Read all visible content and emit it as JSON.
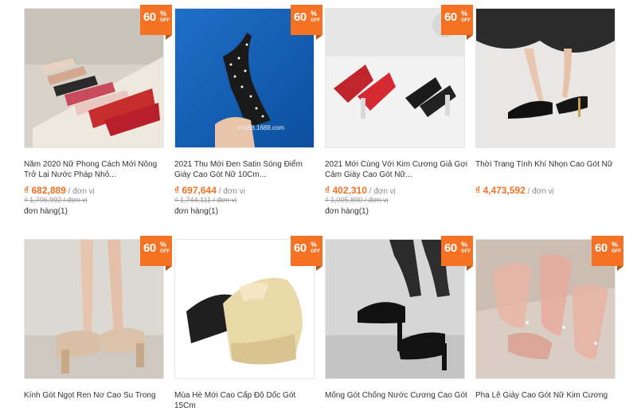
{
  "badge": {
    "percent": "60",
    "symbol": "%",
    "off": "OFF"
  },
  "products": [
    {
      "title": "Năm 2020 Nữ Phong Cách Mới Nông\nTrở Lại Nước Pháp Nhỏ...",
      "price": "₫ 682,889",
      "unit": " / đơn vị",
      "old_price": "₫ 1,706,992 / đơn vị",
      "orders": "đơn hàng(1)"
    },
    {
      "title": "2021 Thu Mới Đen Satin Sóng Điểm\nGiày Cao Gót Nữ 10Cm...",
      "price": "₫ 697,644",
      "unit": " / đơn vị",
      "old_price": "₫ 1,744,111 / đơn vị",
      "orders": "đơn hàng(1)",
      "watermark": "ecd88.1688.com"
    },
    {
      "title": "2021 Mới Cùng Với Kim Cương Giả Gợi\nCảm Giày Cao Gót Nữ...",
      "price": "₫ 402,310",
      "unit": " / đơn vị",
      "old_price": "₫ 1,005,890 / đơn vị",
      "orders": "đơn hàng(1)"
    },
    {
      "title": "Thời Trang Tính Khí Nhọn Cao Gót Nữ",
      "price": "₫ 4,473,592",
      "unit": " / đơn vị",
      "old_price": "",
      "orders": ""
    },
    {
      "title": "Kính Gót Ngọt Ren Nơ Cao Su Trong",
      "price": "",
      "unit": "",
      "old_price": "",
      "orders": ""
    },
    {
      "title": "Mùa Hè Mới Cao Cấp Độ Dốc Gót 15Cm",
      "price": "",
      "unit": "",
      "old_price": "",
      "orders": ""
    },
    {
      "title": "Mống Gót Chống Nước Cương Cao Gót",
      "price": "",
      "unit": "",
      "old_price": "",
      "orders": ""
    },
    {
      "title": "Pha Lê Giày Cao Gót Nữ Kim Cương",
      "price": "",
      "unit": "",
      "old_price": "",
      "orders": ""
    }
  ]
}
